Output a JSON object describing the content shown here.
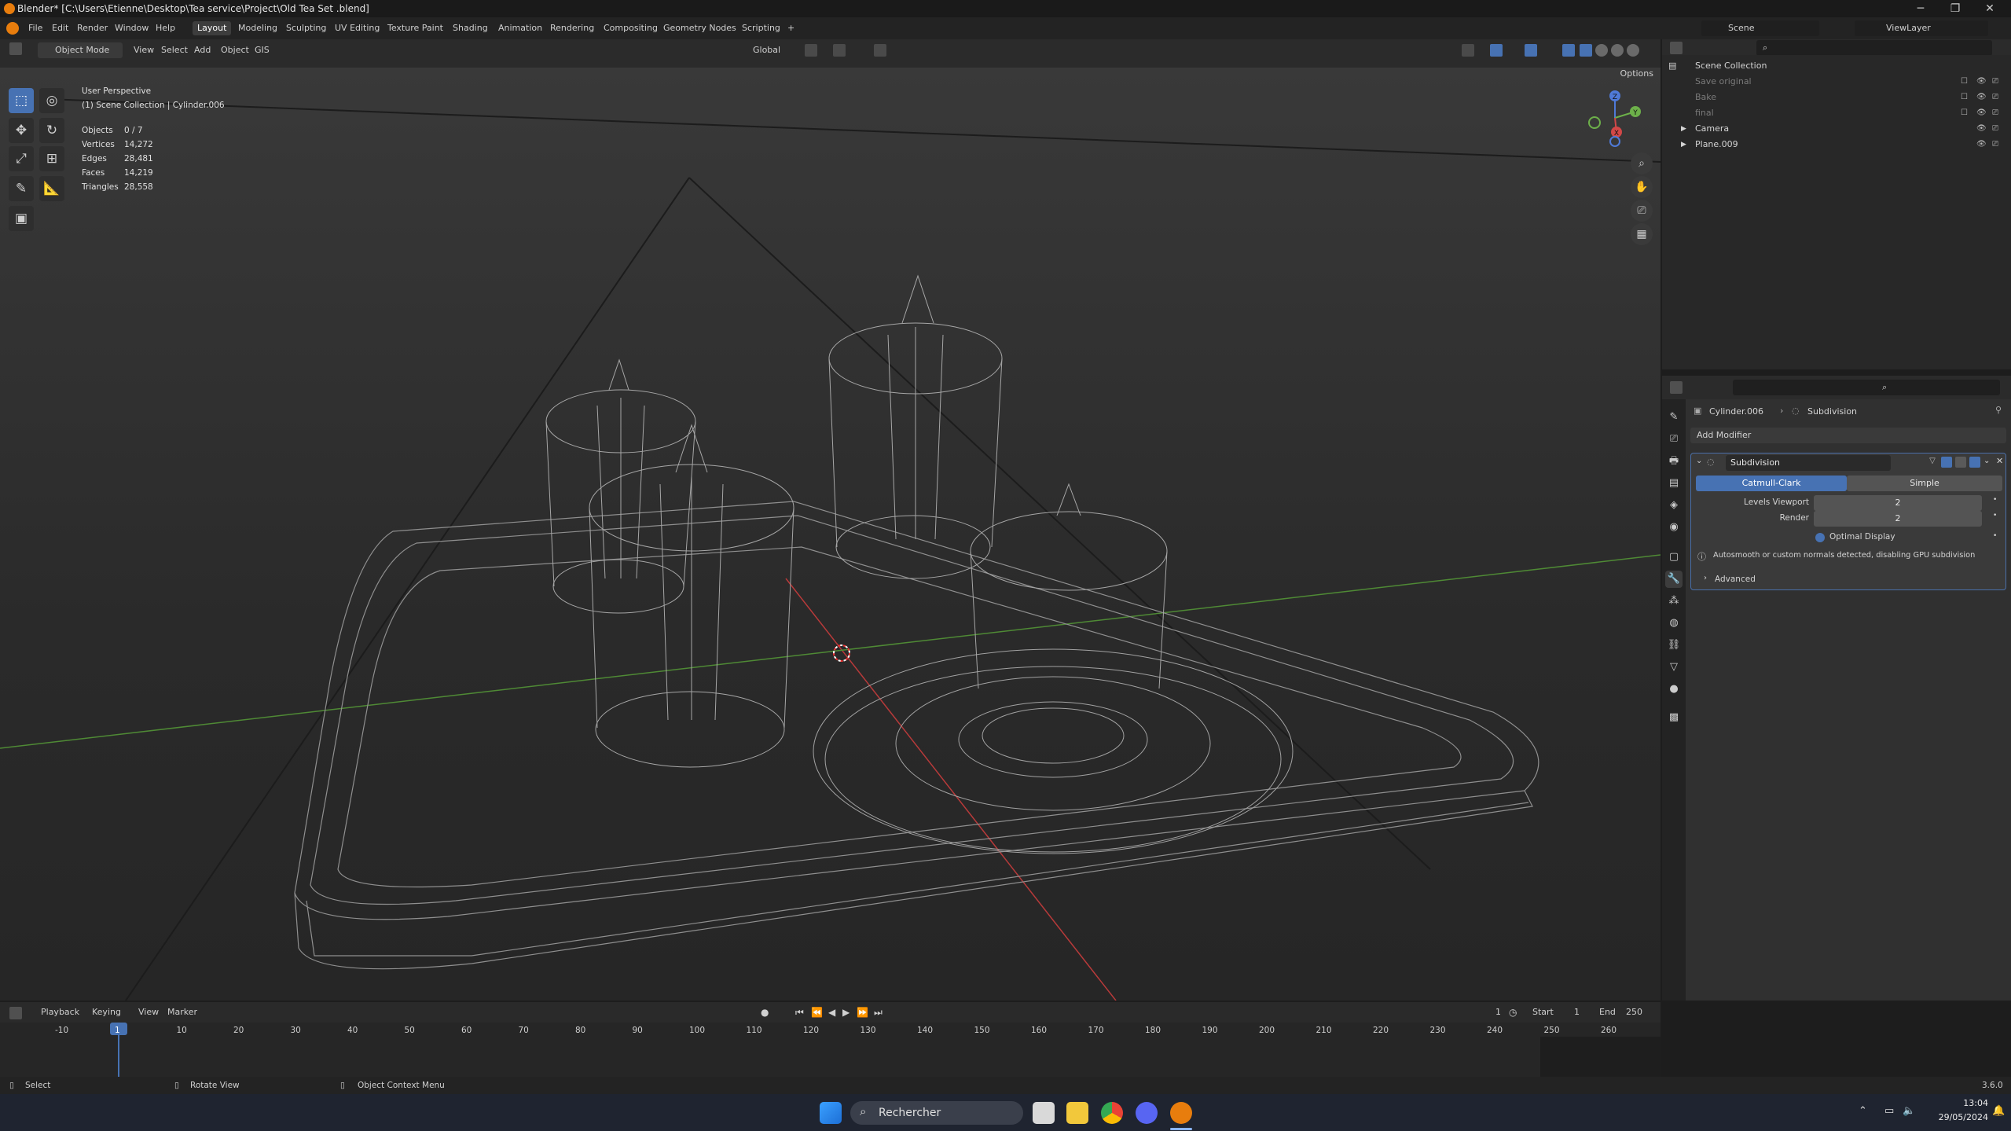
{
  "titlebar": {
    "title": "Blender* [C:\\Users\\Etienne\\Desktop\\Tea service\\Project\\Old Tea Set .blend]",
    "min": "─",
    "max": "❐",
    "close": "✕"
  },
  "menu": {
    "items": [
      "File",
      "Edit",
      "Render",
      "Window",
      "Help"
    ],
    "workspaces": [
      "Layout",
      "Modeling",
      "Sculpting",
      "UV Editing",
      "Texture Paint",
      "Shading",
      "Animation",
      "Rendering",
      "Compositing",
      "Geometry Nodes",
      "Scripting",
      "+"
    ],
    "active_workspace": "Layout",
    "scene": "Scene",
    "view_layer": "ViewLayer"
  },
  "viewport_header": {
    "mode": "Object Mode",
    "menus": [
      "View",
      "Select",
      "Add",
      "Object",
      "GIS"
    ],
    "transform": "Global",
    "options": "Options"
  },
  "viewport": {
    "perspective": "User Perspective",
    "collection": "(1) Scene Collection | Cylinder.006",
    "stats": [
      {
        "label": "Objects",
        "value": "0 / 7"
      },
      {
        "label": "Vertices",
        "value": "14,272"
      },
      {
        "label": "Edges",
        "value": "28,481"
      },
      {
        "label": "Faces",
        "value": "14,219"
      },
      {
        "label": "Triangles",
        "value": "28,558"
      }
    ],
    "gizmo": {
      "x": "X",
      "y": "Y",
      "z": "Z"
    }
  },
  "outliner": {
    "root": "Scene Collection",
    "items": [
      {
        "name": "Save original",
        "enabled": false
      },
      {
        "name": "Bake",
        "enabled": false
      },
      {
        "name": "final",
        "enabled": false
      },
      {
        "name": "Camera",
        "enabled": true
      },
      {
        "name": "Plane.009",
        "enabled": true
      }
    ]
  },
  "properties": {
    "breadcrumb_object": "Cylinder.006",
    "breadcrumb_modifier": "Subdivision",
    "add_modifier": "Add Modifier",
    "modifier": {
      "name": "Subdivision",
      "type_active": "Catmull-Clark",
      "type_other": "Simple",
      "levels_viewport_label": "Levels Viewport",
      "levels_viewport": "2",
      "render_label": "Render",
      "render": "2",
      "optimal_display": "Optimal Display",
      "warning": "Autosmooth or custom normals detected, disabling GPU subdivision",
      "advanced": "Advanced"
    }
  },
  "timeline": {
    "menus": [
      "Playback",
      "Keying",
      "View",
      "Marker"
    ],
    "current_frame": "1",
    "start_label": "Start",
    "start": "1",
    "end_label": "End",
    "end": "250",
    "ticks": [
      "-10",
      "1",
      "10",
      "20",
      "30",
      "40",
      "50",
      "60",
      "70",
      "80",
      "90",
      "100",
      "110",
      "120",
      "130",
      "140",
      "150",
      "160",
      "170",
      "180",
      "190",
      "200",
      "210",
      "220",
      "230",
      "240",
      "250",
      "260"
    ]
  },
  "statusbar": {
    "select": "Select",
    "rotate": "Rotate View",
    "context": "Object Context Menu",
    "version": "3.6.0"
  },
  "taskbar": {
    "search": "Rechercher",
    "time": "13:04",
    "date": "29/05/2024"
  },
  "colors": {
    "accent": "#4772b3",
    "blender_orange": "#e87d0d",
    "axis_x": "#c83a3a",
    "axis_y": "#5ea23a"
  }
}
